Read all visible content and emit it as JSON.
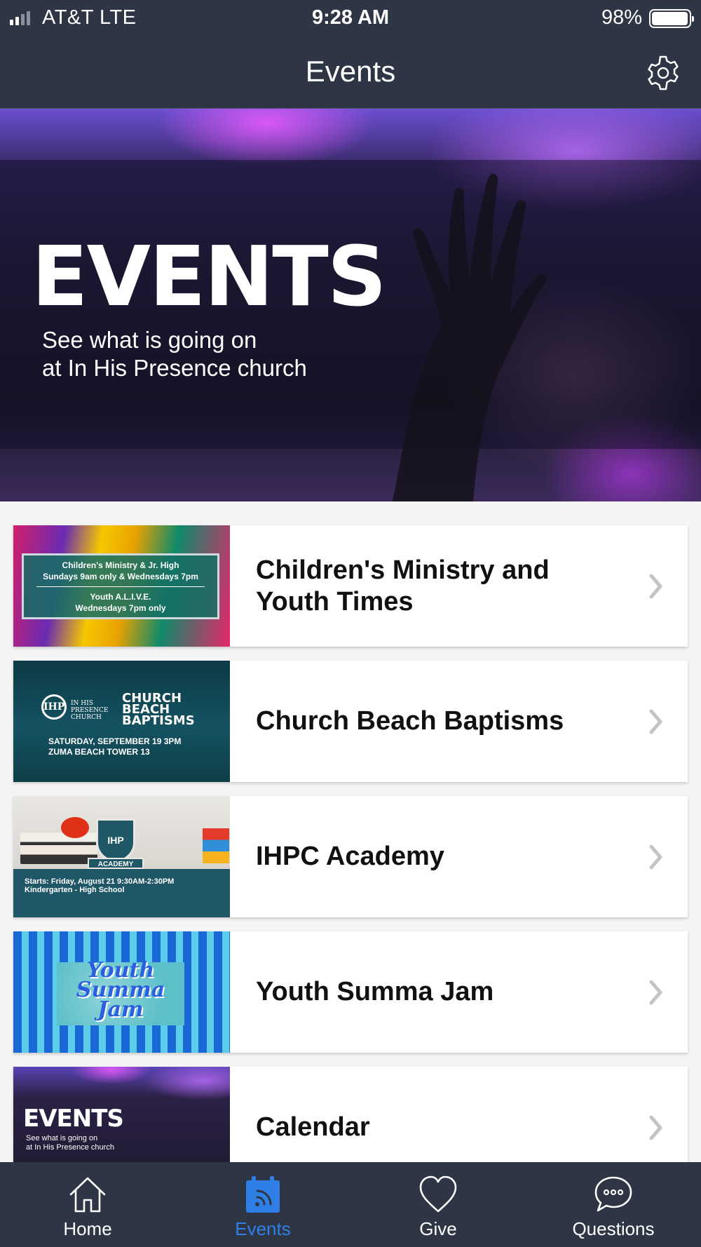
{
  "status_bar": {
    "carrier": "AT&T   LTE",
    "time": "9:28 AM",
    "battery": "98%"
  },
  "nav": {
    "title": "Events",
    "settings_icon": "gear-icon"
  },
  "hero": {
    "title": "EVENTS",
    "subtitle_line1": "See what is going on",
    "subtitle_line2": "at In His Presence church"
  },
  "events": [
    {
      "label": "Children's Ministry and Youth Times",
      "thumb": {
        "line1": "Children's Ministry & Jr. High",
        "line2": "Sundays 9am only & Wednesdays 7pm",
        "line3": "Youth A.L.I.V.E.",
        "line4": "Wednesdays 7pm only"
      }
    },
    {
      "label": "Church Beach Baptisms",
      "thumb": {
        "logo_mark": "IHP",
        "logo_text1": "IN HIS",
        "logo_text2": "PRESENCE",
        "logo_text3": "CHURCH",
        "title1": "CHURCH",
        "title2": "BEACH",
        "title3": "BAPTISMS",
        "info1": "SATURDAY, SEPTEMBER 19 3PM",
        "info2": "ZUMA BEACH TOWER 13"
      }
    },
    {
      "label": "IHPC Academy",
      "thumb": {
        "shield": "IHP",
        "banner": "ACADEMY",
        "info1": "Starts: Friday, August 21 9:30AM-2:30PM",
        "info2": "Kindergarten - High School"
      }
    },
    {
      "label": "Youth Summa Jam",
      "thumb": {
        "line1": "Youth",
        "line2": "Summa",
        "line3": "Jam"
      }
    },
    {
      "label": "Calendar",
      "thumb": {
        "title": "EVENTS",
        "sub1": "See what is going on",
        "sub2": "at In His Presence church"
      }
    }
  ],
  "tabs": [
    {
      "label": "Home",
      "icon": "house-icon",
      "active": false
    },
    {
      "label": "Events",
      "icon": "calendar-feed-icon",
      "active": true
    },
    {
      "label": "Give",
      "icon": "heart-icon",
      "active": false
    },
    {
      "label": "Questions",
      "icon": "chat-bubble-icon",
      "active": false
    }
  ],
  "colors": {
    "bar_background": "#2e3646",
    "active_tab": "#2f7fe6",
    "list_background": "#f4f4f4"
  }
}
